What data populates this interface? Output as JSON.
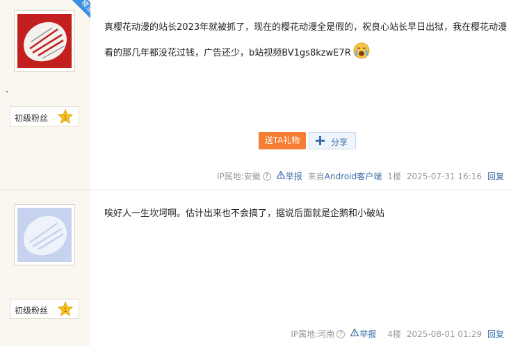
{
  "posts": [
    {
      "corner_tag": "楼主",
      "badge": {
        "label": "初级粉丝",
        "level": "1"
      },
      "text": "真樱花动漫的站长2023年就被抓了，现在的樱花动漫全是假的，祝良心站长早日出狱，我在樱花动漫看的那几年都没花过钱，广告还少，b站视频BV1gs8kzwE7R",
      "emoji_icon": "crying-face-icon",
      "actions": {
        "gift": "送TA礼物",
        "share": "分享"
      },
      "meta": {
        "ip": "IP属地:安徽",
        "report": "举报",
        "client_prefix": "来自",
        "client": "Android客户端",
        "floor": "1楼",
        "time": "2025-07-31 16:16",
        "reply": "回复"
      }
    },
    {
      "badge": {
        "label": "初级粉丝",
        "level": "1"
      },
      "text": "唉好人一生坎坷啊。估计出来也不会搞了，据说后面就是企鹅和小破站",
      "meta": {
        "ip": "IP属地:河南",
        "report": "举报",
        "floor": "4楼",
        "time": "2025-08-01 01:29",
        "reply": "回复"
      }
    }
  ],
  "colors": {
    "sidebar_bg": "#faf6f0",
    "link": "#3b6ea8",
    "gift_btn": "#f57d31",
    "corner_tag": "#3b8fe0"
  }
}
